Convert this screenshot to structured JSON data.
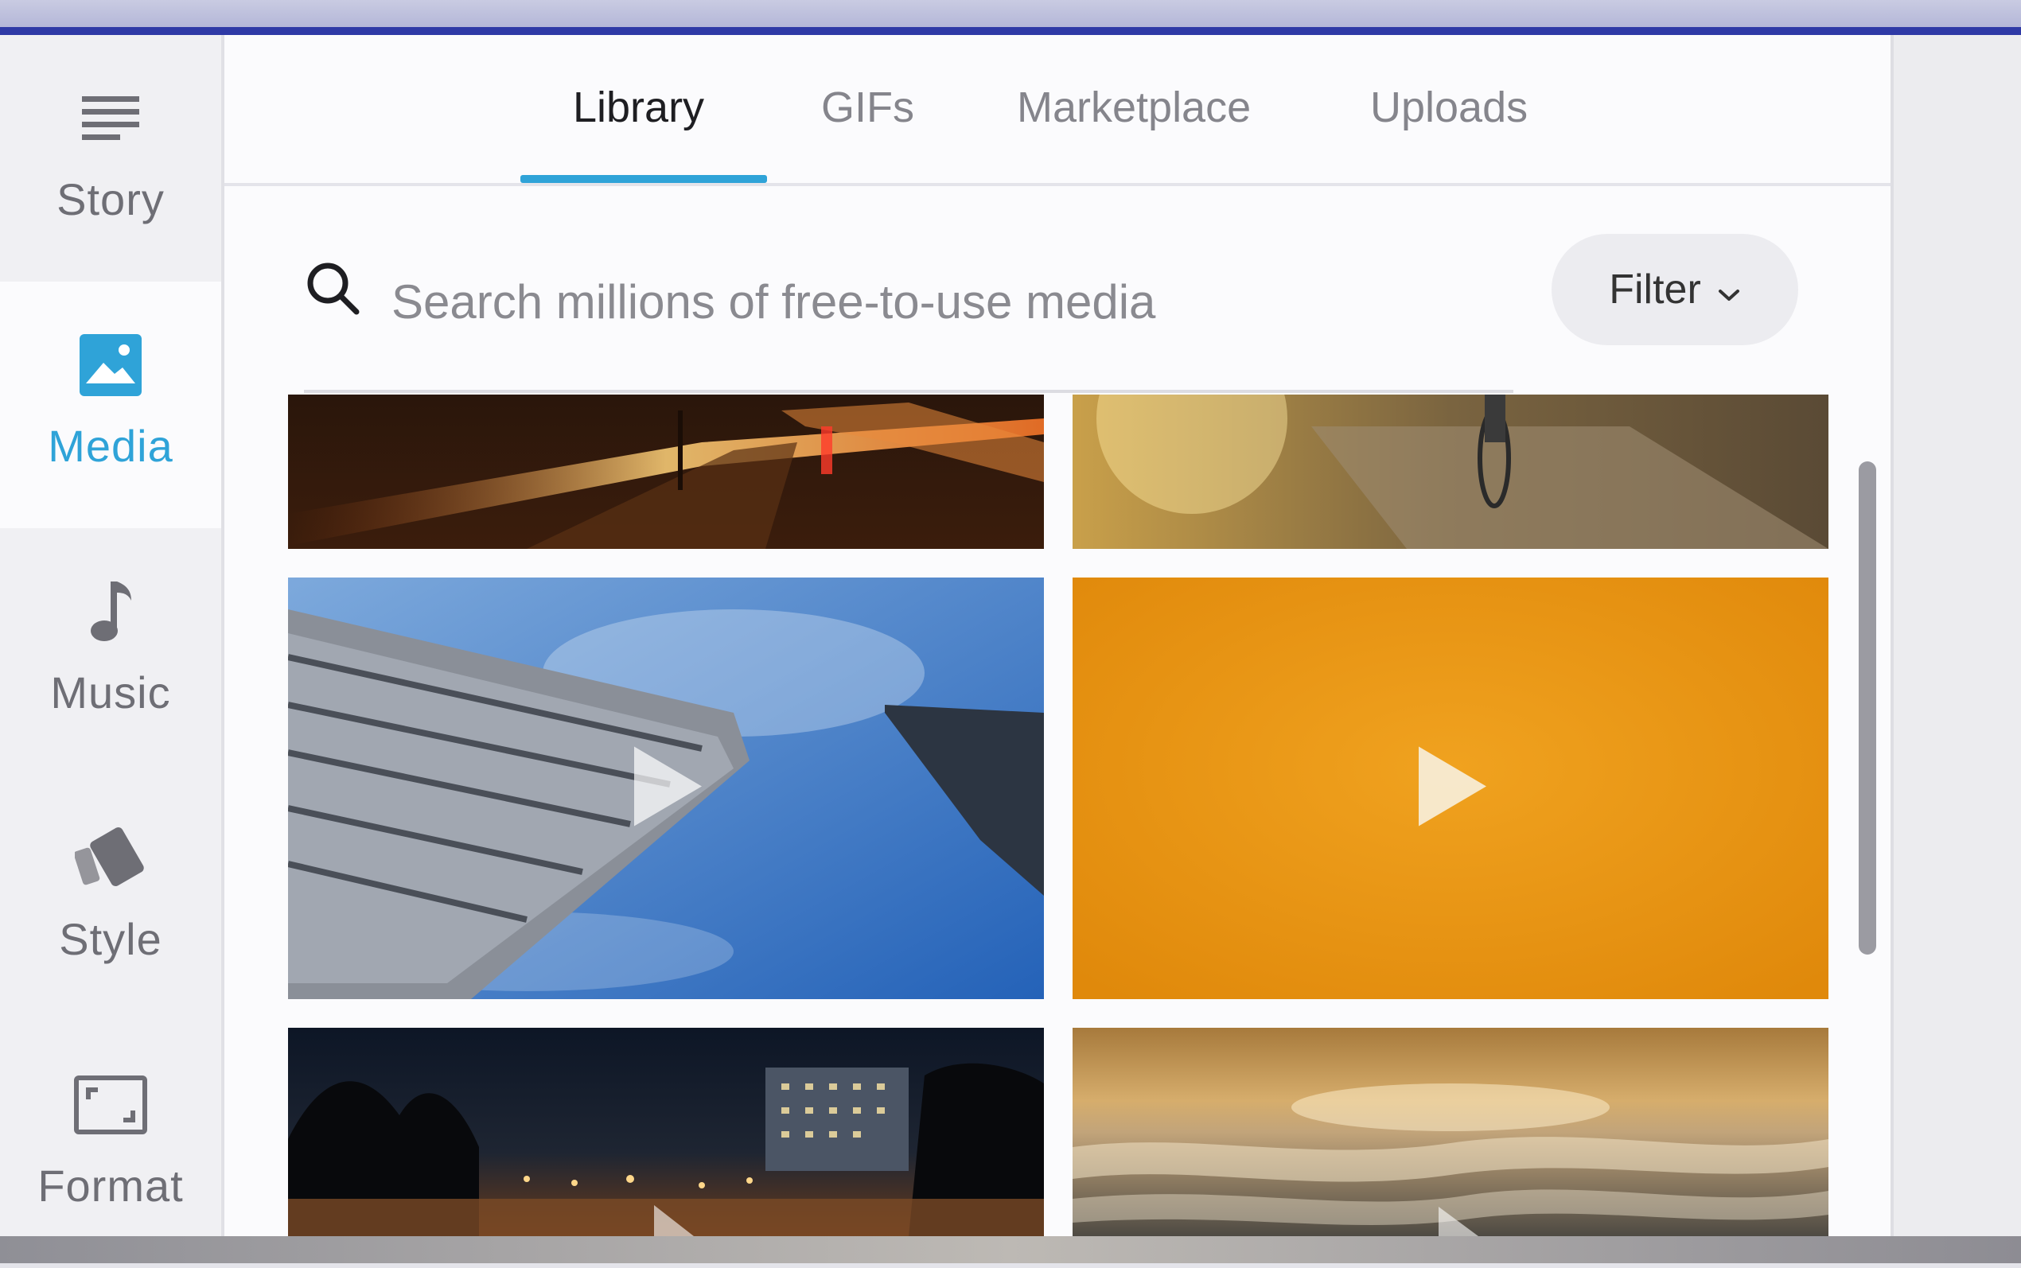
{
  "sidebar": {
    "items": [
      {
        "label": "Story",
        "icon": "menu-lines-icon",
        "active": false
      },
      {
        "label": "Media",
        "icon": "image-icon",
        "active": true
      },
      {
        "label": "Music",
        "icon": "music-note-icon",
        "active": false
      },
      {
        "label": "Style",
        "icon": "style-cards-icon",
        "active": false
      },
      {
        "label": "Format",
        "icon": "aspect-ratio-icon",
        "active": false
      }
    ]
  },
  "tabs": [
    {
      "label": "Library",
      "active": true
    },
    {
      "label": "GIFs",
      "active": false
    },
    {
      "label": "Marketplace",
      "active": false
    },
    {
      "label": "Uploads",
      "active": false
    }
  ],
  "search": {
    "placeholder": "Search millions of free-to-use media",
    "value": ""
  },
  "filter": {
    "label": "Filter",
    "icon": "chevron-down-icon"
  },
  "media_grid": [
    {
      "name": "night-traffic-light-trails",
      "has_play": false
    },
    {
      "name": "bicycle-trail-sunset",
      "has_play": false
    },
    {
      "name": "skyscrapers-blue-sky",
      "has_play": true
    },
    {
      "name": "orange-gradient",
      "has_play": true
    },
    {
      "name": "city-night-skyline",
      "has_play": true
    },
    {
      "name": "ocean-waves-sunset",
      "has_play": true
    }
  ],
  "colors": {
    "accent": "#2fa3d8",
    "top_bar": "#2f3aa6"
  }
}
